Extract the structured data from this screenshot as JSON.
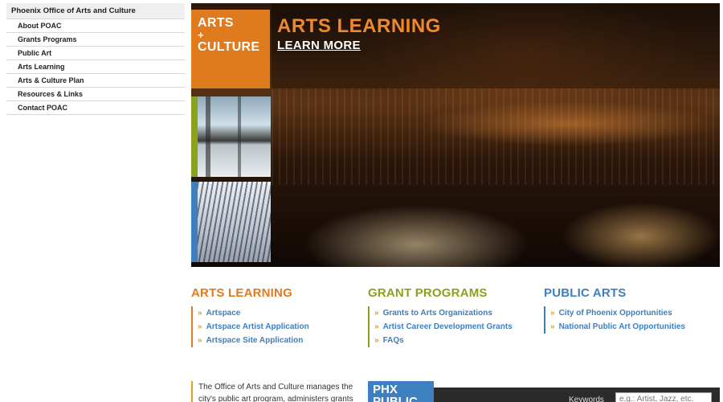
{
  "sidebar": {
    "title": "Phoenix Office of Arts and Culture",
    "items": [
      {
        "label": "About POAC"
      },
      {
        "label": "Grants Programs"
      },
      {
        "label": "Public Art"
      },
      {
        "label": "Arts Learning"
      },
      {
        "label": "Arts & Culture Plan"
      },
      {
        "label": "Resources & Links"
      },
      {
        "label": "Contact POAC"
      }
    ]
  },
  "hero": {
    "logo_line1": "ARTS",
    "logo_line2": "+",
    "logo_line3": "CULTURE",
    "heading": "ARTS LEARNING",
    "link": "LEARN MORE",
    "accent_orange": "#e07a1f",
    "thumb_bar_colors": [
      "#8aa21e",
      "#3d7fbf"
    ]
  },
  "columns": [
    {
      "title": "ARTS LEARNING",
      "color": "#e07a1f",
      "links": [
        "Artspace",
        "Artspace Artist Application",
        "Artspace Site Application"
      ]
    },
    {
      "title": "GRANT PROGRAMS",
      "color": "#8aa21e",
      "links": [
        "Grants to Arts Organizations",
        "Artist Career Development Grants",
        "FAQs"
      ]
    },
    {
      "title": "PUBLIC ARTS",
      "color": "#3d7fbf",
      "links": [
        "City of Phoenix Opportunities",
        "National Public Art Opportunities"
      ]
    }
  ],
  "chevron": "»",
  "bottom": {
    "about_text": "The Office of Arts and Culture manages the city's public art program, administers grants",
    "phx_box": "PHX PUBLIC",
    "keywords_label": "Keywords",
    "search_placeholder": "e.g.: Artist, Jazz, etc."
  }
}
